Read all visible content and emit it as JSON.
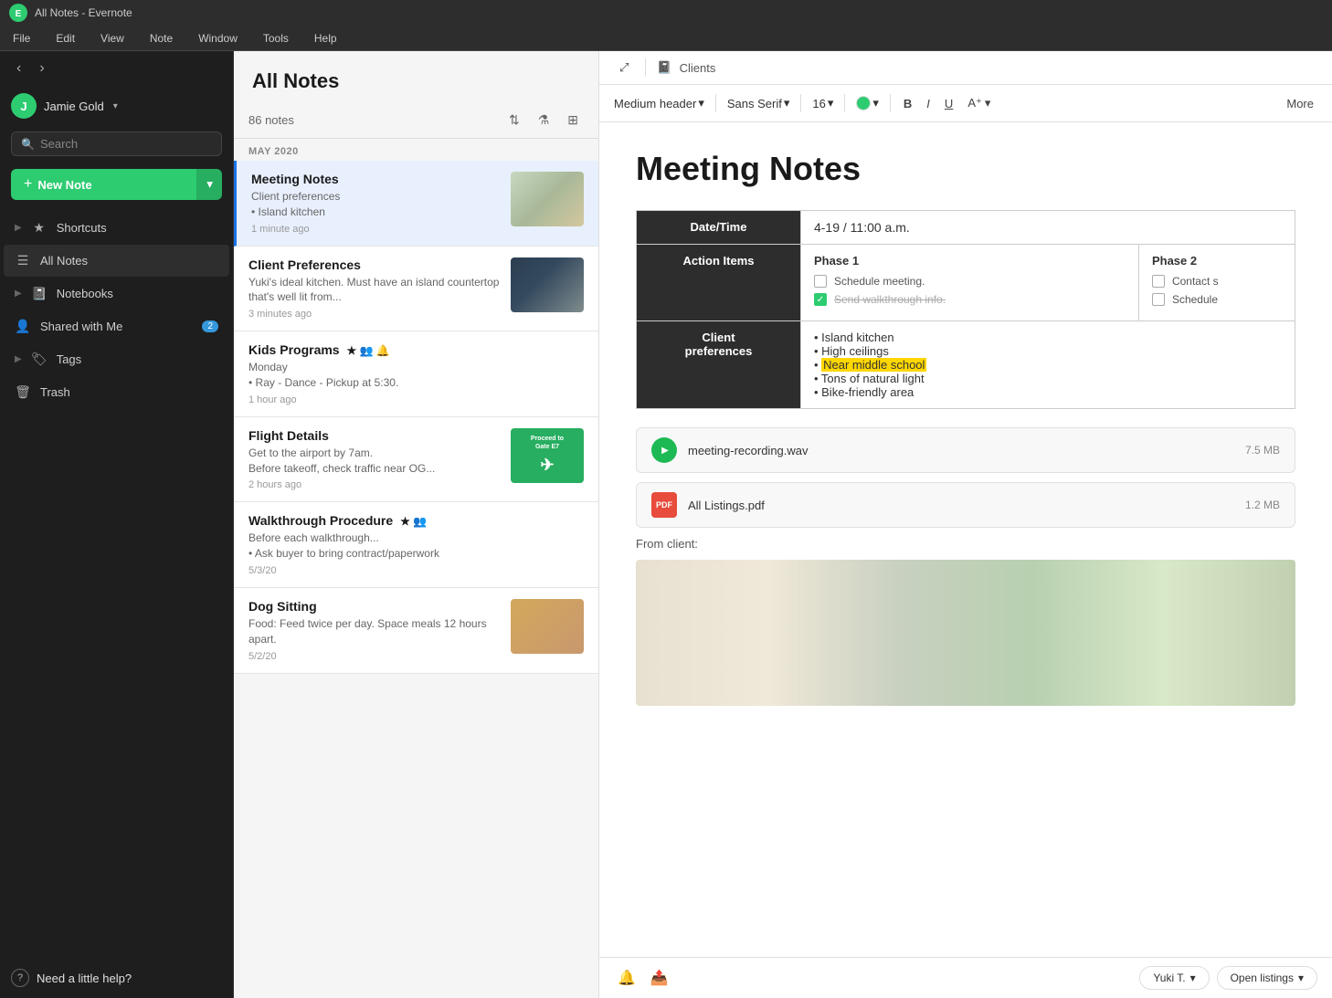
{
  "window": {
    "title": "All Notes - Evernote"
  },
  "menubar": {
    "items": [
      "File",
      "Edit",
      "View",
      "Note",
      "Window",
      "Tools",
      "Help"
    ]
  },
  "sidebar": {
    "user": {
      "initials": "J",
      "name": "Jamie Gold"
    },
    "search_placeholder": "Search",
    "new_note_label": "New Note",
    "items": [
      {
        "id": "shortcuts",
        "label": "Shortcuts",
        "icon": "★",
        "expand": true
      },
      {
        "id": "all-notes",
        "label": "All Notes",
        "icon": "☰",
        "active": true
      },
      {
        "id": "notebooks",
        "label": "Notebooks",
        "icon": "📓",
        "expand": true
      },
      {
        "id": "shared",
        "label": "Shared with Me",
        "icon": "👤",
        "badge": "2"
      },
      {
        "id": "tags",
        "label": "Tags",
        "icon": "🏷",
        "expand": false
      },
      {
        "id": "trash",
        "label": "Trash",
        "icon": "🗑"
      }
    ],
    "help_label": "Need a little help?"
  },
  "notes_panel": {
    "title": "All Notes",
    "count": "86 notes",
    "month": "MAY 2020",
    "notes": [
      {
        "id": 1,
        "title": "Meeting Notes",
        "preview": "Client preferences\n• Island kitchen",
        "time": "1 minute ago",
        "has_thumb": true,
        "thumb_type": "living",
        "active": true
      },
      {
        "id": 2,
        "title": "Client Preferences",
        "preview": "Yuki's ideal kitchen. Must have an island countertop that's well lit from...",
        "time": "3 minutes ago",
        "has_thumb": true,
        "thumb_type": "kitchen"
      },
      {
        "id": 3,
        "title": "Kids Programs",
        "preview": "Monday\n• Ray - Dance - Pickup at 5:30.",
        "time": "1 hour ago",
        "has_thumb": false,
        "icons": [
          "★",
          "👥",
          "🔔"
        ]
      },
      {
        "id": 4,
        "title": "Flight Details",
        "preview": "Get to the airport by 7am.\nBefore takeoff, check traffic near OG...",
        "time": "2 hours ago",
        "has_thumb": true,
        "thumb_type": "boarding"
      },
      {
        "id": 5,
        "title": "Walkthrough Procedure",
        "preview": "Before each walkthrough...\n• Ask buyer to bring contract/paperwork",
        "time": "5/3/20",
        "has_thumb": false,
        "icons": [
          "★",
          "👥"
        ]
      },
      {
        "id": 6,
        "title": "Dog Sitting",
        "preview": "Food: Feed twice per day. Space meals 12 hours apart.",
        "time": "5/2/20",
        "has_thumb": true,
        "thumb_type": "dog"
      }
    ]
  },
  "editor": {
    "notebook_icon": "📓",
    "notebook_name": "Clients",
    "toolbar": {
      "format_label": "Medium header",
      "font_label": "Sans Serif",
      "size_label": "16",
      "bold_label": "B",
      "italic_label": "I",
      "underline_label": "U",
      "more_label": "More"
    },
    "note": {
      "title": "Meeting Notes",
      "table": {
        "rows": [
          {
            "header": "Date/Time",
            "value": "4-19 / 11:00 a.m.",
            "colspan": true
          },
          {
            "header": "Action Items",
            "phase1_header": "Phase 1",
            "phase1_items": [
              {
                "label": "Schedule meeting.",
                "checked": false
              },
              {
                "label": "Send walkthrough info.",
                "checked": true
              }
            ],
            "phase2_header": "Phase 2",
            "phase2_items": [
              {
                "label": "Contact s",
                "checked": false
              },
              {
                "label": "Schedule",
                "checked": false
              }
            ]
          },
          {
            "header": "Client preferences",
            "items": [
              "Island kitchen",
              "High ceilings",
              "Near middle school",
              "Tons of natural light",
              "Bike-friendly area"
            ],
            "highlighted": "Near middle school"
          }
        ]
      },
      "attachments": [
        {
          "id": "wav",
          "type": "audio",
          "name": "meeting-recording.wav",
          "size": "7.5 MB"
        },
        {
          "id": "pdf",
          "type": "pdf",
          "name": "All Listings.pdf",
          "size": "1.2 MB"
        }
      ],
      "from_client_label": "From client:",
      "bottom_toolbar": {
        "user_label": "Yuki T.",
        "listings_label": "Open listings"
      }
    }
  }
}
